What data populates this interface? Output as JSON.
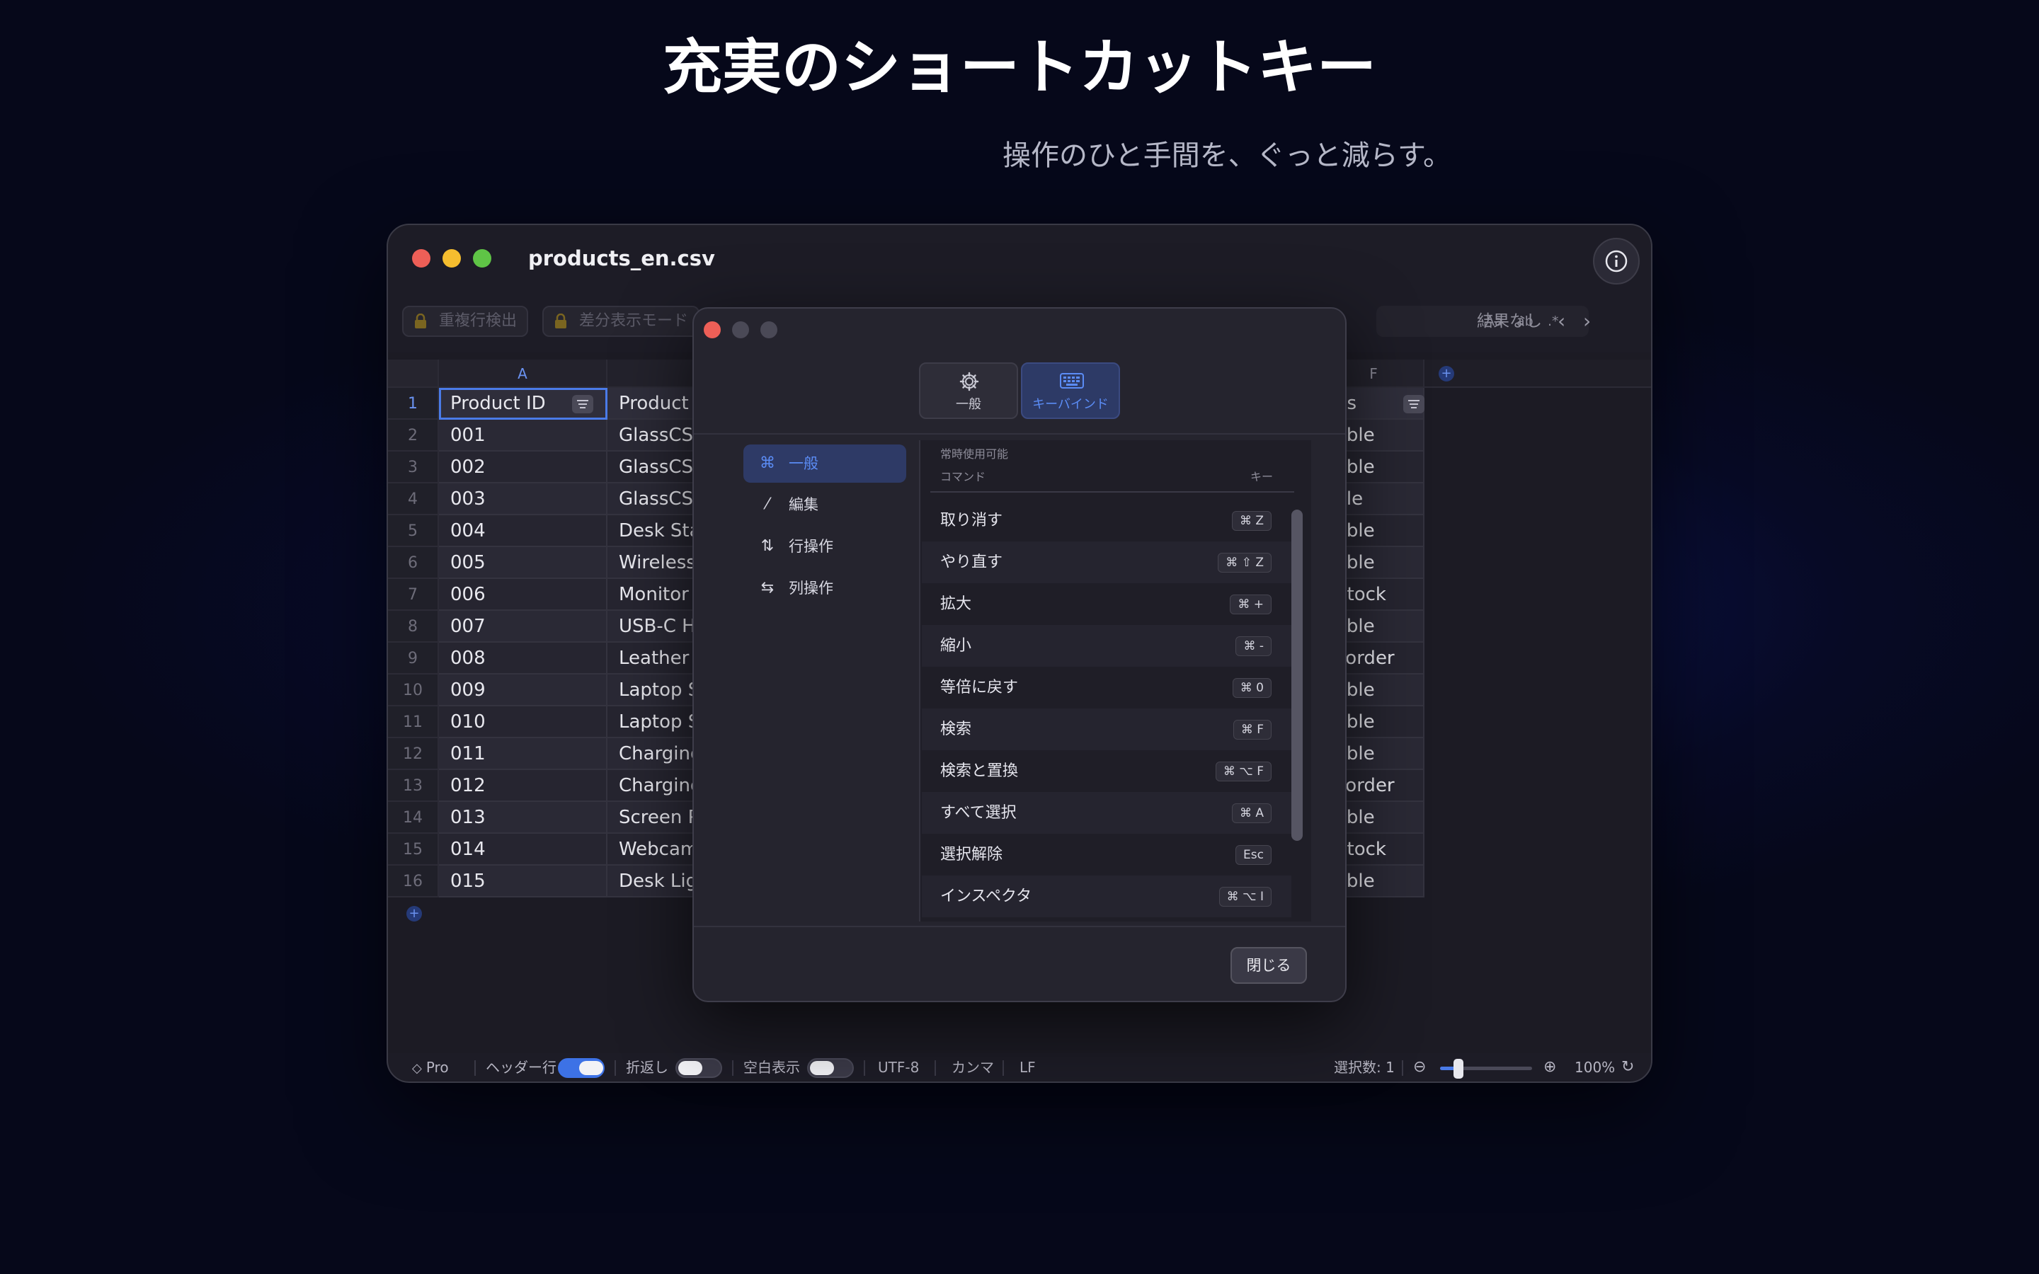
{
  "hero": {
    "title": "充実のショートカットキー",
    "subtitle": "操作のひと手間を、ぐっと減らす。"
  },
  "window": {
    "title": "products_en.csv",
    "info_icon": "info-circle-icon"
  },
  "toolbar": {
    "duplicate_label": "重複行検出",
    "diff_label": "差分表示モード",
    "search_options": {
      "case": "Aa",
      "word": "ab",
      "regex": ".*"
    },
    "search_result": "結果なし",
    "prev": "‹",
    "next": "›"
  },
  "grid": {
    "columns": [
      "A",
      "F"
    ],
    "header": {
      "col_a": "Product ID",
      "col_b": "Product N",
      "col_f": "us"
    },
    "rows": [
      {
        "num": "1"
      },
      {
        "num": "2",
        "a": "001",
        "b": "GlassCSV",
        "f": "able"
      },
      {
        "num": "3",
        "a": "002",
        "b": "GlassCSV",
        "f": "able"
      },
      {
        "num": "4",
        "a": "003",
        "b": "GlassCSV",
        "f": "ale"
      },
      {
        "num": "5",
        "a": "004",
        "b": "Desk Star",
        "f": "able"
      },
      {
        "num": "6",
        "a": "005",
        "b": "Wireless",
        "f": "able"
      },
      {
        "num": "7",
        "a": "006",
        "b": "Monitor A",
        "f": "Stock"
      },
      {
        "num": "8",
        "a": "007",
        "b": "USB-C Hu",
        "f": "able"
      },
      {
        "num": "9",
        "a": "008",
        "b": "Leather M",
        "f": "corder"
      },
      {
        "num": "10",
        "a": "009",
        "b": "Laptop Sl",
        "f": "able"
      },
      {
        "num": "11",
        "a": "010",
        "b": "Laptop Sl",
        "f": "able"
      },
      {
        "num": "12",
        "a": "011",
        "b": "Charging",
        "f": "able"
      },
      {
        "num": "13",
        "a": "012",
        "b": "Charging",
        "f": "corder"
      },
      {
        "num": "14",
        "a": "013",
        "b": "Screen Pr",
        "f": "able"
      },
      {
        "num": "15",
        "a": "014",
        "b": "Webcam",
        "f": "Stock"
      },
      {
        "num": "16",
        "a": "015",
        "b": "Desk Ligh",
        "f": "able"
      }
    ]
  },
  "status": {
    "pro": "Pro",
    "header_row": "ヘッダー行",
    "header_row_on": true,
    "wrap": "折返し",
    "wrap_on": false,
    "whitespace": "空白表示",
    "whitespace_on": false,
    "encoding": "UTF-8",
    "delimiter": "カンマ",
    "line_ending": "LF",
    "selection": "選択数: 1",
    "zoom": "100%",
    "zoom_level": 0.2
  },
  "dialog": {
    "tabs": [
      {
        "label": "一般",
        "icon": "gear-icon"
      },
      {
        "label": "キーバインド",
        "icon": "keyboard-icon"
      }
    ],
    "sidebar": [
      {
        "label": "一般",
        "icon": "⌘"
      },
      {
        "label": "編集",
        "icon": "⁄"
      },
      {
        "label": "行操作",
        "icon": "⇅"
      },
      {
        "label": "列操作",
        "icon": "⇆"
      }
    ],
    "section_caption": "常時使用可能",
    "col_command": "コマンド",
    "col_key": "キー",
    "shortcuts": [
      {
        "name": "取り消す",
        "key": "⌘ Z"
      },
      {
        "name": "やり直す",
        "key": "⌘ ⇧ Z"
      },
      {
        "name": "拡大",
        "key": "⌘ +"
      },
      {
        "name": "縮小",
        "key": "⌘ -"
      },
      {
        "name": "等倍に戻す",
        "key": "⌘ 0"
      },
      {
        "name": "検索",
        "key": "⌘ F"
      },
      {
        "name": "検索と置換",
        "key": "⌘ ⌥ F"
      },
      {
        "name": "すべて選択",
        "key": "⌘ A"
      },
      {
        "name": "選択解除",
        "key": "Esc"
      },
      {
        "name": "インスペクタ",
        "key": "⌘ ⌥ I"
      }
    ],
    "close_label": "閉じる"
  },
  "colors": {
    "accent": "#4a7be8",
    "red": "#ed5f57",
    "yellow": "#f5bd2f",
    "green": "#5fc446"
  }
}
